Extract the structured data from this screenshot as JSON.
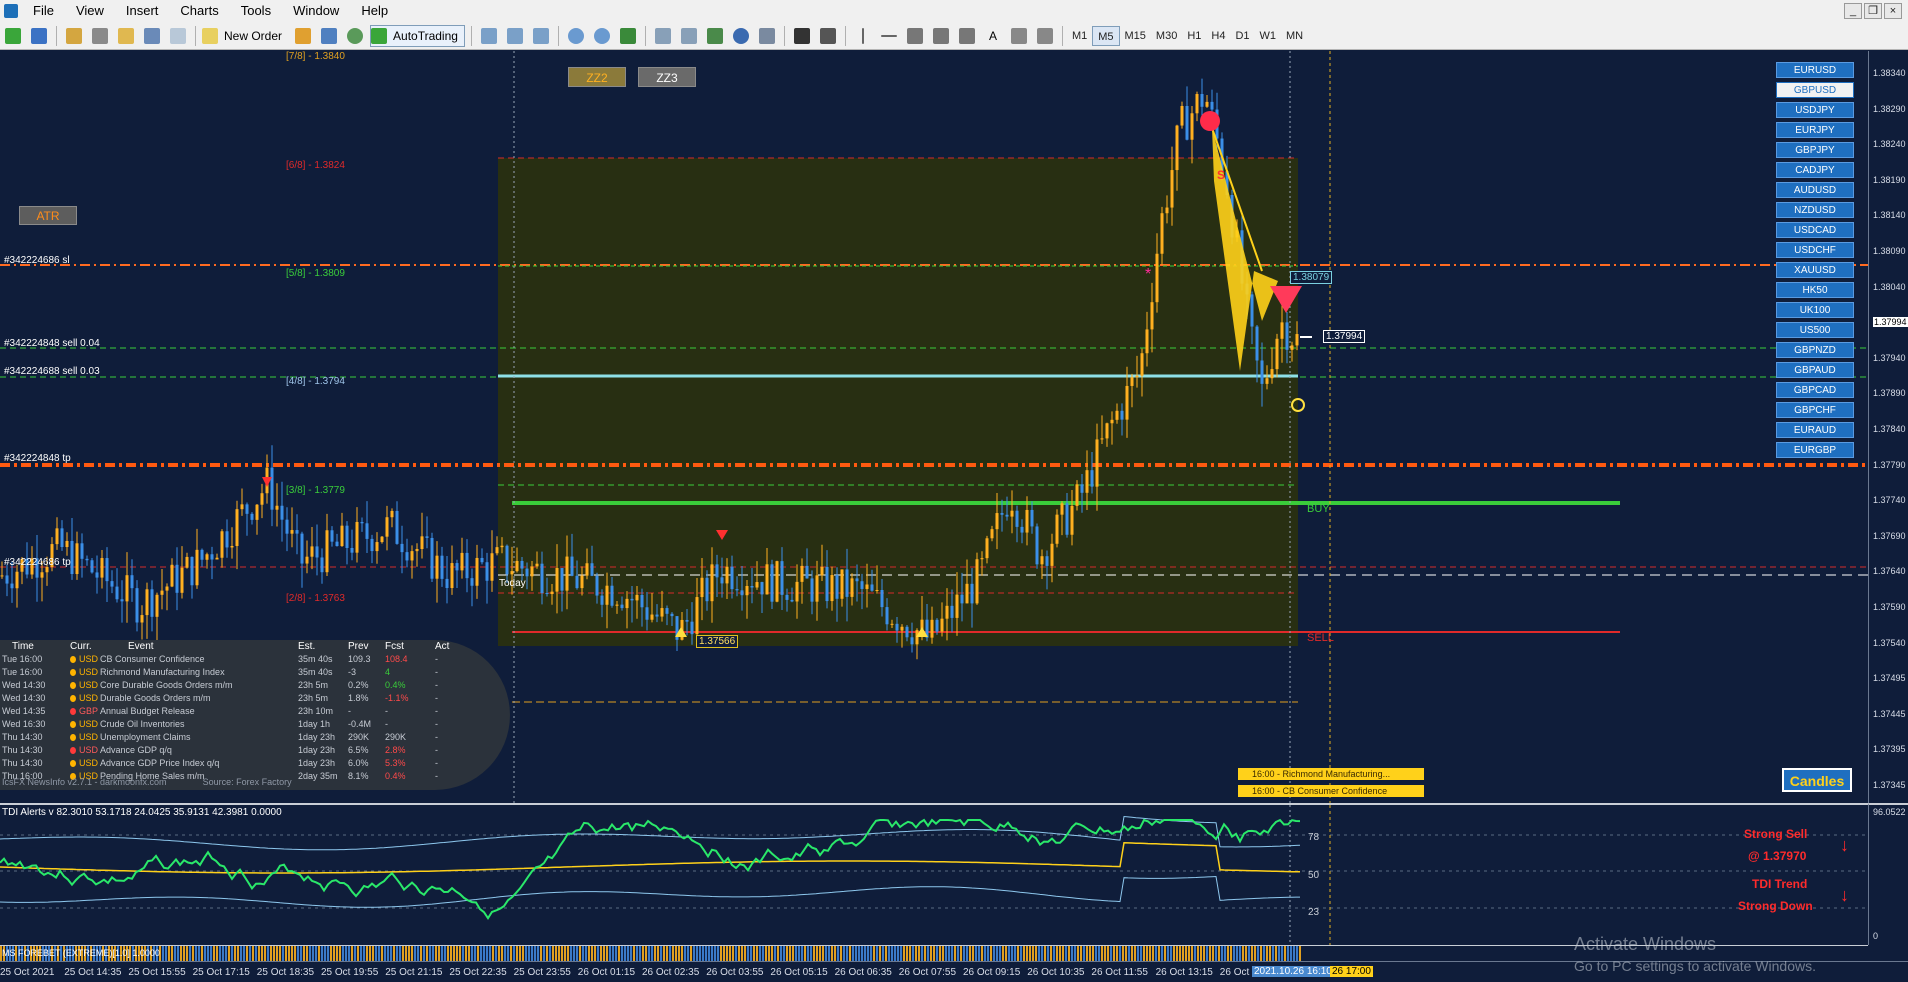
{
  "menu": {
    "items": [
      "File",
      "View",
      "Insert",
      "Charts",
      "Tools",
      "Window",
      "Help"
    ]
  },
  "toolbar": {
    "new_order_label": "New Order",
    "autotrading_label": "AutoTrading",
    "timeframes": [
      "M1",
      "M5",
      "M15",
      "M30",
      "H1",
      "H4",
      "D1",
      "W1",
      "MN"
    ],
    "active_timeframe": "M5"
  },
  "chart": {
    "buttons": {
      "zz2": "ZZ2",
      "zz3": "ZZ3",
      "atr": "ATR",
      "candles": "Candles"
    },
    "murrey_levels": [
      {
        "label": "[7/8] - 1.3840",
        "color": "#e0a020"
      },
      {
        "label": "[6/8] - 1.3824",
        "color": "#e02a2a"
      },
      {
        "label": "[5/8] - 1.3809",
        "color": "#3acd3a"
      },
      {
        "label": "[4/8] - 1.3794",
        "color": "#9ec3e8"
      },
      {
        "label": "[3/8] - 1.3779",
        "color": "#3acd3a"
      },
      {
        "label": "[2/8] - 1.3763",
        "color": "#e02a2a"
      }
    ],
    "order_labels": [
      {
        "label": "#342224686 sl",
        "color": "#ffffff"
      },
      {
        "label": "#342224848 sell 0.04",
        "color": "#ffffff"
      },
      {
        "label": "#342224688 sell 0.03",
        "color": "#ffffff"
      },
      {
        "label": "#342224848 tp",
        "color": "#ffffff"
      },
      {
        "label": "#342224686 tp",
        "color": "#ffffff"
      }
    ],
    "price_tags": {
      "low": "1.37566",
      "zone": "1.38079",
      "current": "1.37994"
    },
    "line_labels": {
      "buy": "BUY",
      "sell": "SELL",
      "today": "Today",
      "s_marker": "S"
    },
    "news_tags": [
      "16:00 - Richmond Manufacturing...",
      "16:00 - CB Consumer Confidence"
    ]
  },
  "symbols": {
    "items": [
      "EURUSD",
      "GBPUSD",
      "USDJPY",
      "EURJPY",
      "GBPJPY",
      "CADJPY",
      "AUDUSD",
      "NZDUSD",
      "USDCAD",
      "USDCHF",
      "XAUUSD",
      "HK50",
      "UK100",
      "US500",
      "GBPNZD",
      "GBPAUD",
      "GBPCAD",
      "GBPCHF",
      "EURAUD",
      "EURGBP"
    ],
    "active": "GBPUSD"
  },
  "price_axis": {
    "ticks": [
      "1.38340",
      "1.38290",
      "1.38240",
      "1.38190",
      "1.38140",
      "1.38090",
      "1.38040",
      "1.37994",
      "1.37940",
      "1.37890",
      "1.37840",
      "1.37790",
      "1.37740",
      "1.37690",
      "1.37640",
      "1.37590",
      "1.37540",
      "1.37495",
      "1.37445",
      "1.37395",
      "1.37345"
    ]
  },
  "news": {
    "headers": {
      "time": "Time",
      "curr": "Curr.",
      "event": "Event",
      "est": "Est.",
      "prev": "Prev",
      "fcst": "Fcst",
      "act": "Act"
    },
    "rows": [
      {
        "time": "Tue  16:00",
        "curr": "USD",
        "dot": "#ffb400",
        "event": "CB Consumer Confidence",
        "est": "35m 40s",
        "prev": "109.3",
        "fcst": "108.4",
        "fcst_color": "#ff4a4a",
        "act": "-"
      },
      {
        "time": "Tue  16:00",
        "curr": "USD",
        "dot": "#ffb400",
        "event": "Richmond Manufacturing Index",
        "est": "35m 40s",
        "prev": "-3",
        "fcst": "4",
        "fcst_color": "#3acd3a",
        "act": "-"
      },
      {
        "time": "Wed 14:30",
        "curr": "USD",
        "dot": "#ffb400",
        "event": "Core Durable Goods Orders m/m",
        "est": "23h 5m",
        "prev": "0.2%",
        "fcst": "0.4%",
        "fcst_color": "#3acd3a",
        "act": "-"
      },
      {
        "time": "Wed 14:30",
        "curr": "USD",
        "dot": "#ffb400",
        "event": "Durable Goods Orders m/m",
        "est": "23h 5m",
        "prev": "1.8%",
        "fcst": "-1.1%",
        "fcst_color": "#ff4a4a",
        "act": "-"
      },
      {
        "time": "Wed 14:35",
        "curr": "GBP",
        "dot": "#ff3a3a",
        "event": "Annual Budget Release",
        "est": "23h 10m",
        "prev": "-",
        "fcst": "-",
        "fcst_color": "#c7ccd4",
        "act": "-"
      },
      {
        "time": "Wed 16:30",
        "curr": "USD",
        "dot": "#ffb400",
        "event": "Crude Oil Inventories",
        "est": "1day 1h",
        "prev": "-0.4M",
        "fcst": "-",
        "fcst_color": "#c7ccd4",
        "act": "-"
      },
      {
        "time": "Thu  14:30",
        "curr": "USD",
        "dot": "#ffb400",
        "event": "Unemployment Claims",
        "est": "1day 23h",
        "prev": "290K",
        "fcst": "290K",
        "fcst_color": "#c7ccd4",
        "act": "-"
      },
      {
        "time": "Thu  14:30",
        "curr": "USD",
        "dot": "#ff3a3a",
        "event": "Advance GDP q/q",
        "est": "1day 23h",
        "prev": "6.5%",
        "fcst": "2.8%",
        "fcst_color": "#ff4a4a",
        "act": "-"
      },
      {
        "time": "Thu  14:30",
        "curr": "USD",
        "dot": "#ffb400",
        "event": "Advance GDP Price Index q/q",
        "est": "1day 23h",
        "prev": "6.0%",
        "fcst": "5.3%",
        "fcst_color": "#ff4a4a",
        "act": "-"
      },
      {
        "time": "Thu  16:00",
        "curr": "USD",
        "dot": "#ffb400",
        "event": "Pending Home Sales m/m",
        "est": "2day 35m",
        "prev": "8.1%",
        "fcst": "0.4%",
        "fcst_color": "#ff4a4a",
        "act": "-"
      }
    ],
    "footer": {
      "brand": "IcsFX NewsInfo v2.7.1  -  darkmoonfx.com",
      "source": "Source: Forex Factory"
    }
  },
  "tdi": {
    "title": "TDI Alerts v 82.3010 53.1718 24.0425 35.9131 42.3981 0.0000",
    "levels": [
      "78",
      "50",
      "23"
    ],
    "axis_top": "96.0522",
    "axis_bottom": "0",
    "alert_line1": "Strong Sell",
    "alert_line2": "@ 1.37970",
    "alert_line3": "TDI Trend",
    "alert_line4": "Strong Down"
  },
  "strip": {
    "label": "MS FOREBET (EXTREME)[1.0] 1.0000"
  },
  "time_axis": {
    "ticks": [
      "25 Oct 2021",
      "25 Oct 14:35",
      "25 Oct 15:55",
      "25 Oct 17:15",
      "25 Oct 18:35",
      "25 Oct 19:55",
      "25 Oct 21:15",
      "25 Oct 22:35",
      "25 Oct 23:55",
      "26 Oct 01:15",
      "26 Oct 02:35",
      "26 Oct 03:55",
      "26 Oct 05:15",
      "26 Oct 06:35",
      "26 Oct 07:55",
      "26 Oct 09:15",
      "26 Oct 10:35",
      "26 Oct 11:55",
      "26 Oct 13:15",
      "26 Oct 1"
    ],
    "highlight_current": "2021.10.26 16:10",
    "highlight_next": "26 17:00"
  },
  "watermark": {
    "line1": "Activate Windows",
    "line2": "Go to PC settings to activate Windows."
  },
  "chart_data": {
    "type": "candlestick",
    "symbol": "GBPUSD",
    "timeframe": "M5",
    "ylim": [
      1.3734,
      1.384
    ],
    "last_price": 1.37994
  }
}
